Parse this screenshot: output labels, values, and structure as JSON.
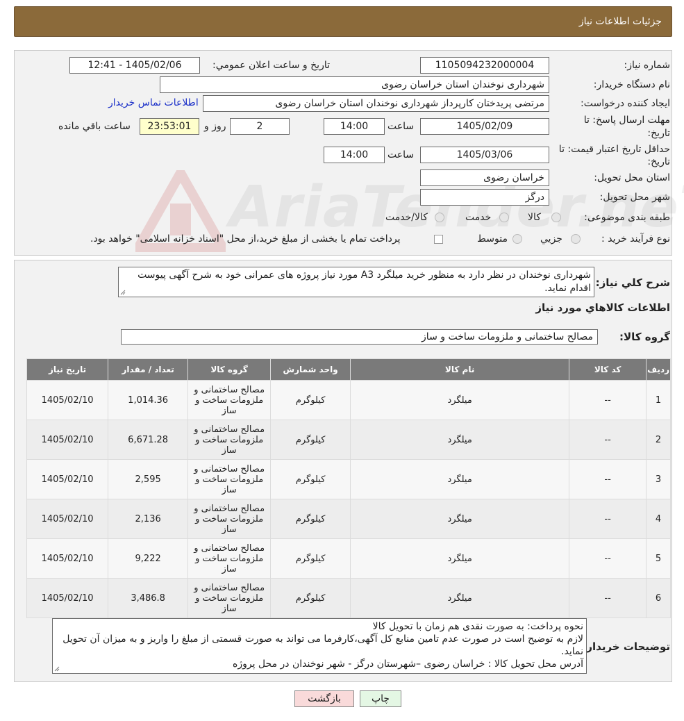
{
  "header": {
    "title": "جزئیات اطلاعات نیاز"
  },
  "watermark": {
    "text": "AriaTender.neT"
  },
  "form": {
    "need_number_label": "شماره نیاز:",
    "need_number": "1105094232000004",
    "announce_label": "تاریخ و ساعت اعلان عمومي:",
    "announce_value": "1405/02/06 - 12:41",
    "buyer_org_label": "نام دستگاه خریدار:",
    "buyer_org": "شهرداری نوخندان استان خراسان رضوی",
    "creator_label": "ایجاد کننده درخواست:",
    "creator": "مرتضی پریدختان کارپرداز شهرداری نوخندان استان خراسان رضوی",
    "contact_link": "اطلاعات تماس خریدار",
    "deadline_label_1": "مهلت ارسال پاسخ: تا",
    "deadline_label_2": "تاریخ:",
    "deadline_date": "1405/02/09",
    "time_label": "ساعت",
    "deadline_time": "14:00",
    "days_value": "2",
    "days_label": "روز و",
    "remaining_time": "23:53:01",
    "remaining_label": "ساعت باقي مانده",
    "validity_label_1": "حداقل تاریخ اعتبار قیمت: تا",
    "validity_label_2": "تاریخ:",
    "validity_date": "1405/03/06",
    "validity_time": "14:00",
    "province_label": "استان محل تحویل:",
    "province": "خراسان رضوی",
    "city_label": "شهر محل تحویل:",
    "city": "درگز",
    "category_label": "طبقه بندی موضوعی:",
    "category_options": [
      "کالا",
      "خدمت",
      "کالا/خدمت"
    ],
    "process_label": "نوع فرآیند خرید :",
    "process_options": [
      "جزیي",
      "متوسط"
    ],
    "payment_note": "پرداخت تمام یا بخشی از مبلغ خرید،از محل \"اسناد خزانه اسلامی\" خواهد بود."
  },
  "summary": {
    "label": "شرح کلي نیاز:",
    "text": "شهرداری نوخندان در نظر دارد به منظور خرید میلگرد A3 مورد نیاز پروژه های عمرانی خود به شرح آگهی پیوست اقدام نماید."
  },
  "goods": {
    "section_title": "اطلاعات کالاهاي مورد نیاز",
    "group_label": "گروه کالا:",
    "group_value": "مصالح ساختمانی و ملزومات ساخت و ساز",
    "columns": [
      "ردیف",
      "کد کالا",
      "نام کالا",
      "واحد شمارش",
      "گروه کالا",
      "تعداد / مقدار",
      "تاریخ نیاز"
    ],
    "rows": [
      [
        "1",
        "--",
        "میلگرد",
        "کیلوگرم",
        "مصالح ساختمانی و ملزومات ساخت و ساز",
        "1,014.36",
        "1405/02/10"
      ],
      [
        "2",
        "--",
        "میلگرد",
        "کیلوگرم",
        "مصالح ساختمانی و ملزومات ساخت و ساز",
        "6,671.28",
        "1405/02/10"
      ],
      [
        "3",
        "--",
        "میلگرد",
        "کیلوگرم",
        "مصالح ساختمانی و ملزومات ساخت و ساز",
        "2,595",
        "1405/02/10"
      ],
      [
        "4",
        "--",
        "میلگرد",
        "کیلوگرم",
        "مصالح ساختمانی و ملزومات ساخت و ساز",
        "2,136",
        "1405/02/10"
      ],
      [
        "5",
        "--",
        "میلگرد",
        "کیلوگرم",
        "مصالح ساختمانی و ملزومات ساخت و ساز",
        "9,222",
        "1405/02/10"
      ],
      [
        "6",
        "--",
        "میلگرد",
        "کیلوگرم",
        "مصالح ساختمانی و ملزومات ساخت و ساز",
        "3,486.8",
        "1405/02/10"
      ]
    ]
  },
  "buyer_notes": {
    "label": "توضیحات خریدار:",
    "lines": [
      "نحوه پرداخت: به صورت نقدی هم زمان با تحویل کالا",
      "لازم به توضیح است در صورت عدم تامین منابع کل آگهی،کارفرما می تواند به صورت قسمتی از مبلغ را واریز و به میزان آن تحویل نماید.",
      "آدرس محل تحویل کالا : خراسان رضوی –شهرستان درگز  - شهر نوخندان در محل پروژه"
    ]
  },
  "buttons": {
    "print": "چاپ",
    "back": "بازگشت"
  },
  "colors": {
    "header_bg": "#8b6a3a",
    "link": "#1a2fc8",
    "table_header_bg": "#7a7a7a",
    "back_button_bg": "#f9dada",
    "print_button_bg": "#e4f7e4"
  }
}
